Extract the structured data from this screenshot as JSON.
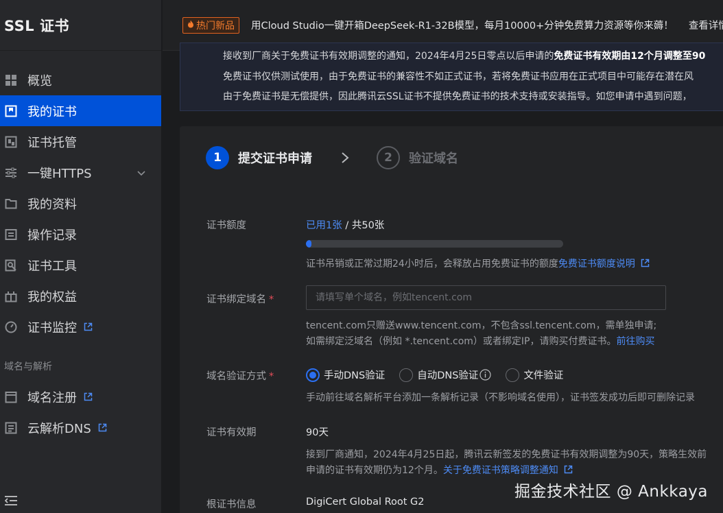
{
  "sidebar": {
    "title": "SSL 证书",
    "items": [
      {
        "label": "概览",
        "icon": "grid-icon"
      },
      {
        "label": "我的证书",
        "icon": "certificate-icon",
        "active": true
      },
      {
        "label": "证书托管",
        "icon": "hosting-icon"
      },
      {
        "label": "一键HTTPS",
        "icon": "sliders-icon"
      },
      {
        "label": "我的资料",
        "icon": "folder-icon"
      },
      {
        "label": "操作记录",
        "icon": "log-icon"
      },
      {
        "label": "证书工具",
        "icon": "tool-icon"
      },
      {
        "label": "我的权益",
        "icon": "gift-icon"
      },
      {
        "label": "证书监控",
        "icon": "monitor-icon"
      }
    ],
    "section_label": "域名与解析",
    "section_items": [
      {
        "label": "域名注册",
        "icon": "calendar-icon"
      },
      {
        "label": "云解析DNS",
        "icon": "dns-icon"
      }
    ]
  },
  "topbar": {
    "tag": "热门新品",
    "text": "用Cloud Studio一键开箱DeepSeek-R1-32B模型，每月10000+分钟免费算力资源等你来薅！",
    "link": "查看详情"
  },
  "notice": {
    "line1_prefix": "接收到厂商关于免费证书有效期调整的通知，2024年4月25日零点以后申请的",
    "line1_bold": "免费证书有效期由12个月调整至90",
    "line2": "免费证书仅供测试使用，由于免费证书的兼容性不如正式证书，若将免费证书应用在正式项目中可能存在潜在风",
    "line3": "由于免费证书是无偿提供，因此腾讯云SSL证书不提供免费证书的技术支持或安装指导。如您申请中遇到问题，"
  },
  "steps": [
    {
      "num": "1",
      "label": "提交证书申请"
    },
    {
      "num": "2",
      "label": "验证域名"
    }
  ],
  "form": {
    "quota_label": "证书额度",
    "quota_used": "已用1张",
    "quota_total": " / 共50张",
    "quota_progress_percent": 2,
    "quota_help": "证书吊销或正常过期24小时后，会释放占用免费证书的额度",
    "quota_help_link": "免费证书额度说明",
    "domain_label": "证书绑定域名",
    "domain_placeholder": "请填写单个域名，例如tencent.com",
    "domain_help1": "tencent.com只赠送www.tencent.com，不包含ssl.tencent.com，需单独申请;",
    "domain_help2": "如需绑定泛域名（例如 *.tencent.com）或者绑定IP，请购买付费证书。",
    "domain_help2_link": "前往购买",
    "verify_label": "域名验证方式",
    "verify_options": [
      "手动DNS验证",
      "自动DNS验证",
      "文件验证"
    ],
    "verify_help": "手动前往域名解析平台添加一条解析记录（不影响域名使用），证书签发成功后即可删除记录",
    "validity_label": "证书有效期",
    "validity_value": "90天",
    "validity_help1": "接到厂商通知，2024年4月25日起，腾讯云新签发的免费证书有效期调整为90天，策略生效前",
    "validity_help2": "申请的证书有效期仍为12个月。",
    "validity_help2_link": "关于免费证书策略调整通知",
    "root_label": "根证书信息",
    "root_value": "DigiCert Global Root G2"
  },
  "watermark": "掘金技术社区 @ Ankkaya"
}
